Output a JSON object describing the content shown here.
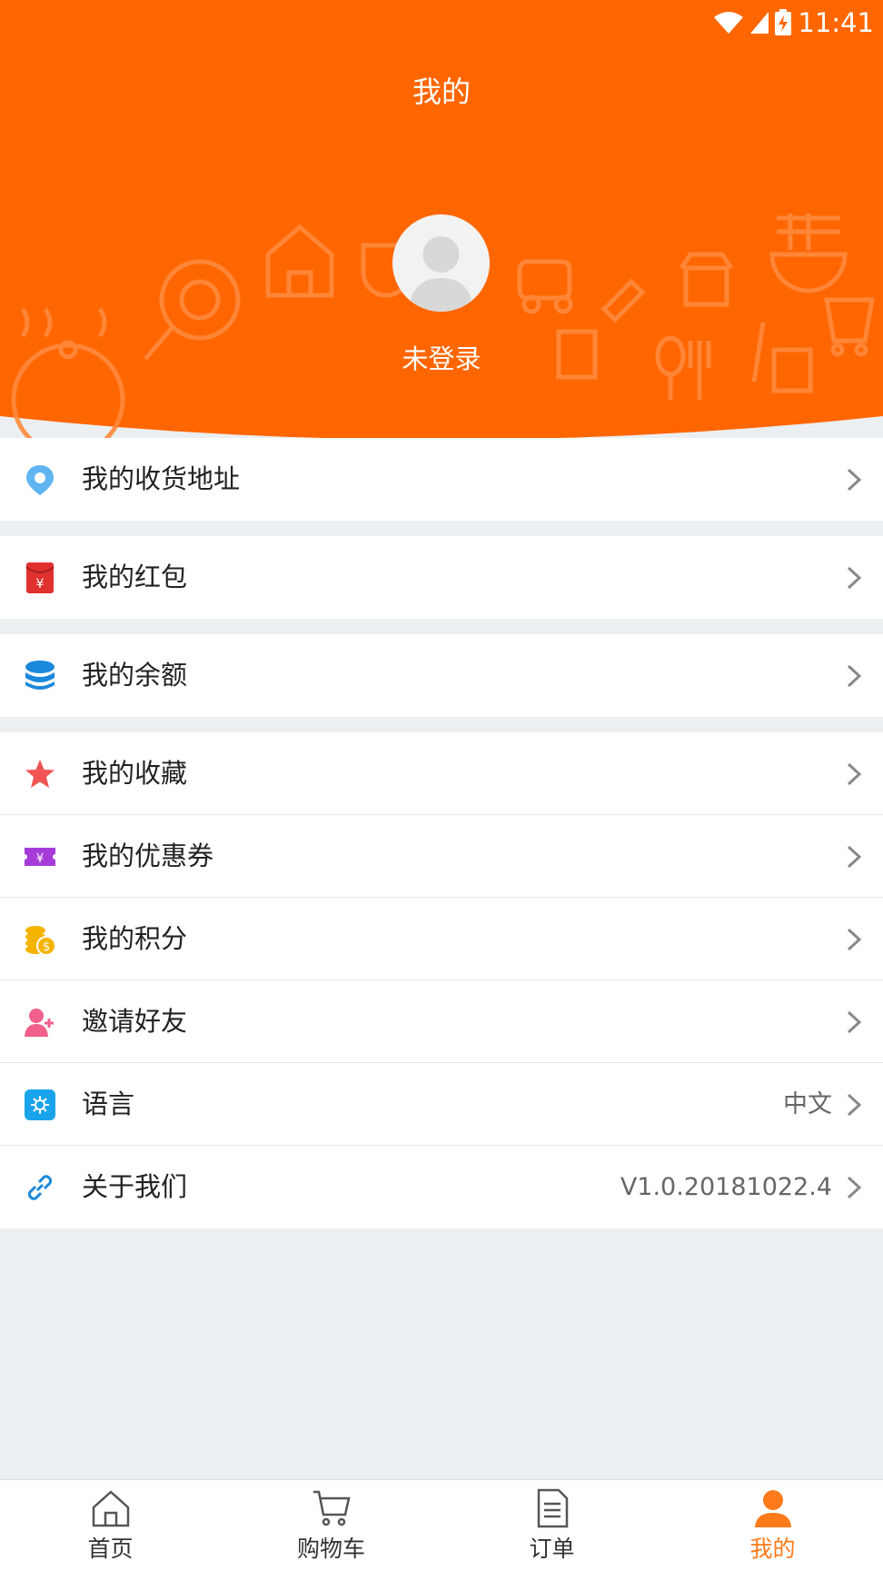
{
  "status_bar": {
    "time": "11:41"
  },
  "header": {
    "title": "我的",
    "login_status": "未登录"
  },
  "colors": {
    "brand": "#ff6600",
    "tab_active": "#ff7a1a"
  },
  "menu": {
    "address": {
      "label": "我的收货地址",
      "icon": "location-pin-icon"
    },
    "red_packet": {
      "label": "我的红包",
      "icon": "red-envelope-icon"
    },
    "balance": {
      "label": "我的余额",
      "icon": "coin-stack-icon"
    },
    "favorites": {
      "label": "我的收藏",
      "icon": "star-icon"
    },
    "coupons": {
      "label": "我的优惠券",
      "icon": "coupon-icon"
    },
    "points": {
      "label": "我的积分",
      "icon": "gold-coins-icon"
    },
    "invite": {
      "label": "邀请好友",
      "icon": "add-user-icon"
    },
    "language": {
      "label": "语言",
      "value": "中文",
      "icon": "language-icon"
    },
    "about": {
      "label": "关于我们",
      "value": "V1.0.20181022.4",
      "icon": "link-icon"
    }
  },
  "tabs": [
    {
      "label": "首页",
      "icon": "home-icon"
    },
    {
      "label": "购物车",
      "icon": "cart-icon"
    },
    {
      "label": "订单",
      "icon": "order-document-icon"
    },
    {
      "label": "我的",
      "icon": "profile-icon",
      "active": true
    }
  ]
}
